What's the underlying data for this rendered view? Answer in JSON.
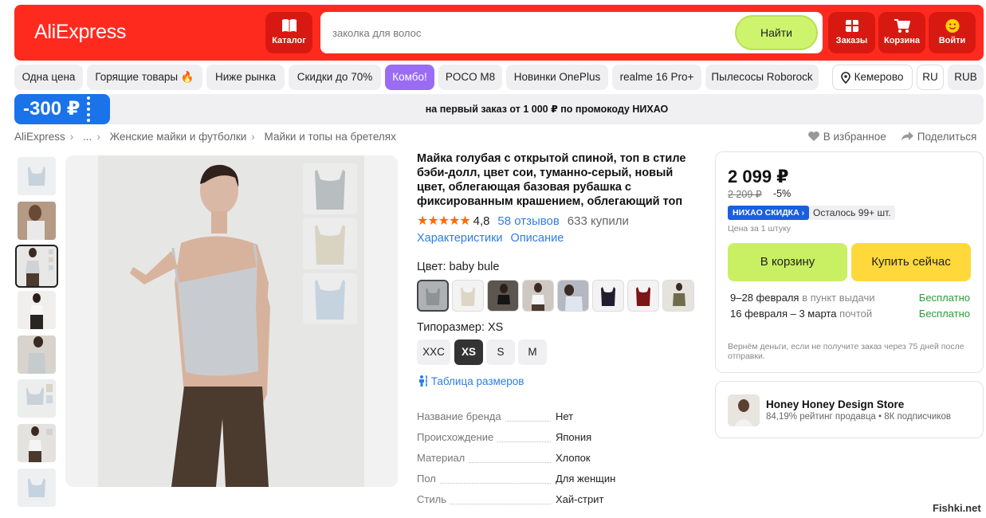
{
  "header": {
    "logo": "AliExpress",
    "catalog_label": "Каталог",
    "search_placeholder": "заколка для волос",
    "search_button": "Найти",
    "orders_label": "Заказы",
    "cart_label": "Корзина",
    "login_label": "Войти",
    "brand_color": "#ff2a1e"
  },
  "chips": {
    "items": [
      "Одна цена",
      "Горящие товары 🔥",
      "Ниже рынка",
      "Скидки до 70%",
      "Комбо!",
      "POCO M8",
      "Новинки OnePlus",
      "realme 16 Pro+",
      "Пылесосы Roborock"
    ],
    "active": "Комбо!",
    "city": "Кемерово",
    "lang": "RU",
    "currency": "RUB"
  },
  "promo": {
    "badge": "-300 ₽",
    "text": "на первый заказ от 1 000 ₽ по промокоду НИХАО"
  },
  "breadcrumb": {
    "items": [
      "AliExpress",
      "...",
      "Женские майки и футболки",
      "Майки и топы на бретелях"
    ],
    "favorite": "В избранное",
    "share": "Поделиться"
  },
  "product": {
    "title": "Майка голубая с открытой спиной, топ в стиле бэби-долл, цвет сои, туманно-серый, новый цвет, облегающая базовая рубашка с фиксированным крашением, облегающий топ",
    "stars": "★★★★★",
    "rating": "4,8",
    "reviews": "58 отзывов",
    "sold": "633 купили",
    "tab_specs": "Характеристики",
    "tab_desc": "Описание",
    "color_label": "Цвет: baby bule",
    "size_label": "Типоразмер: XS",
    "sizes": [
      "XXC",
      "XS",
      "S",
      "M"
    ],
    "selected_size": "XS",
    "size_table": "Таблица размеров",
    "specs": [
      {
        "k": "Название бренда",
        "v": "Нет"
      },
      {
        "k": "Происхождение",
        "v": "Япония"
      },
      {
        "k": "Материал",
        "v": "Хлопок"
      },
      {
        "k": "Пол",
        "v": "Для женщин"
      },
      {
        "k": "Стиль",
        "v": "Хай-стрит"
      }
    ]
  },
  "buy": {
    "price": "2 099 ₽",
    "old_price": "2 209 ₽",
    "discount": "-5%",
    "badge": "НИХАО СКИДКА ›",
    "stock": "Осталось 99+ шт.",
    "per_unit": "Цена за 1 штуку",
    "cart_button": "В корзину",
    "buy_button": "Купить сейчас",
    "delivery1_dates": "9–28 февраля",
    "delivery1_where": "в пункт выдачи",
    "delivery1_price": "Бесплатно",
    "delivery2_dates": "16 февраля – 3 марта",
    "delivery2_where": "почтой",
    "delivery2_price": "Бесплатно",
    "refund": "Вернём деньги, если не получите заказ через 75 дней после отправки."
  },
  "store": {
    "name": "Honey Honey Design Store",
    "meta": "84,19% рейтинг продавца  •  8К подписчиков"
  },
  "watermark": "Fishki.net"
}
